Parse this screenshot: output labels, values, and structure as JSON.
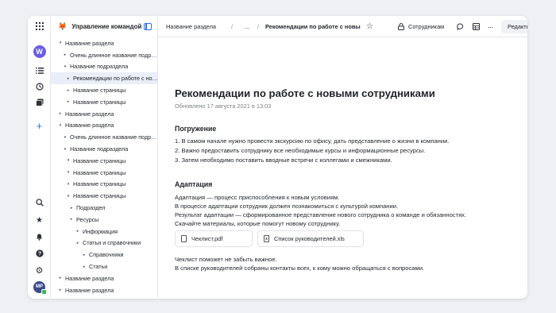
{
  "workspace": {
    "title": "Управление командой",
    "user_initial": "W",
    "profile_initials": "MP"
  },
  "tree": [
    {
      "label": "Название раздела",
      "level": 0,
      "arrow": "▾"
    },
    {
      "label": "Очень длинное название подраздела",
      "level": 1,
      "arrow": "▸"
    },
    {
      "label": "Название подраздела",
      "level": 1,
      "arrow": "▾"
    },
    {
      "label": "Рекомендации по работе с новыми сотрудниками",
      "level": 2,
      "arrow": "▸",
      "active": true
    },
    {
      "label": "Название страницы",
      "level": 2,
      "arrow": "▸"
    },
    {
      "label": "Название страницы",
      "level": 2,
      "arrow": "▸"
    },
    {
      "label": "Название раздела",
      "level": 0,
      "arrow": "▸"
    },
    {
      "label": "Название раздела",
      "level": 0,
      "arrow": "▾"
    },
    {
      "label": "Очень длинное название подраздела",
      "level": 1,
      "arrow": "▾"
    },
    {
      "label": "Название подраздела",
      "level": 1,
      "arrow": "▾"
    },
    {
      "label": "Название страницы",
      "level": 2,
      "arrow": "▾"
    },
    {
      "label": "Название страницы",
      "level": 2,
      "arrow": "▾"
    },
    {
      "label": "Название страницы",
      "level": 2,
      "arrow": "▾"
    },
    {
      "label": "Название страницы",
      "level": 2,
      "arrow": "▾"
    },
    {
      "label": "Подраздел",
      "level": 3,
      "arrow": "▸"
    },
    {
      "label": "Ресурсы",
      "level": 3,
      "arrow": "▸"
    },
    {
      "label": "Информация",
      "level": 4,
      "arrow": "▸"
    },
    {
      "label": "Статьи и справочники",
      "level": 4,
      "arrow": "▸"
    },
    {
      "label": "Справочники",
      "level": 5,
      "arrow": "▸"
    },
    {
      "label": "Статьи",
      "level": 5,
      "arrow": "▸"
    },
    {
      "label": "Название раздела",
      "level": 0,
      "arrow": "▸"
    },
    {
      "label": "Название раздела",
      "level": 0,
      "arrow": "▸"
    }
  ],
  "topbar": {
    "crumb1": "Название раздела",
    "sep": "/",
    "ellipsis": "...",
    "current": "Рекомендации по работе с новыми сотрудниками",
    "share_label": "Сотрудникам",
    "more": "···",
    "edit_label": "Редактировать"
  },
  "page": {
    "title": "Рекомендации по работе с новыми сотрудниками",
    "updated": "Обновлено 17 августа 2021 в 13:03",
    "section1_title": "Погружение",
    "list": [
      "1. В самом начале нужно провести экскурсию по офису, дать представление о жизни в компании.",
      "2. Важно предоставить сотруднику все необходимые курсы и информационные ресурсы.",
      "3. Затем необходимо поставить вводные встречи с коллегами и смежниками."
    ],
    "section2_title": "Адаптация",
    "paragraph": [
      "Адаптация — процесс приспособления к новым условиям.",
      "В процессе адаптации сотрудник должен познакомиться с культурой компании.",
      "Результат адаптации — сформированное представление нового сотрудника о команде и обязанностях.",
      "Скачайте материалы, которые помогут новому сотруднику."
    ],
    "files": [
      {
        "name": "Чеклист.pdf",
        "icon": "pdf-file-icon"
      },
      {
        "name": "Список руководителей.xls",
        "icon": "xls-file-icon"
      }
    ],
    "footer": [
      "Чеклист поможет не забыть важное.",
      "В списке руководителей собраны контакты всех, к кому можно обращаться с вопросами."
    ]
  }
}
